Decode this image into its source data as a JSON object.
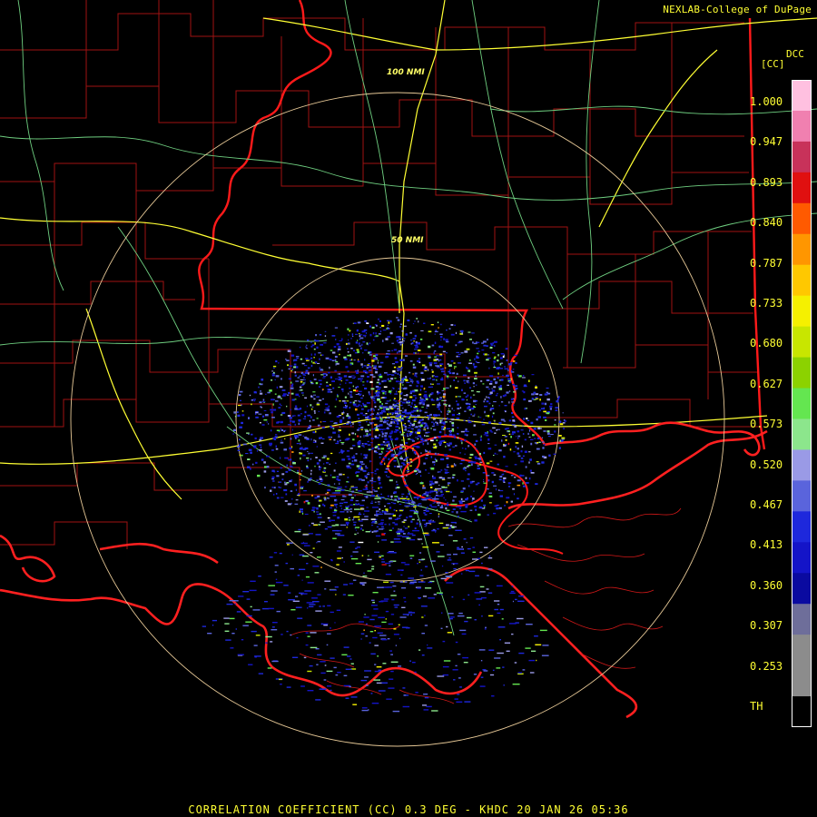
{
  "credit": "NEXLAB-College of DuPage",
  "bottom_title": "CORRELATION COEFFICIENT (CC) 0.3 DEG - KHDC 20 JAN 26 05:36",
  "product_code": "DCC",
  "unit": "[CC]",
  "range_rings": [
    {
      "label": "100 NMI"
    },
    {
      "label": "50 NMI"
    }
  ],
  "colorbar": {
    "labels": [
      "1.000",
      "0.947",
      "0.893",
      "0.840",
      "0.787",
      "0.733",
      "0.680",
      "0.627",
      "0.573",
      "0.520",
      "0.467",
      "0.413",
      "0.360",
      "0.307",
      "0.253",
      "TH"
    ],
    "colors": [
      "#ffc0e0",
      "#f080b0",
      "#c8325a",
      "#e01010",
      "#ff5a00",
      "#ff9600",
      "#ffc800",
      "#f5f000",
      "#c8e600",
      "#8cd200",
      "#64e650",
      "#8ce68c",
      "#9a9ae6",
      "#5a64dc",
      "#1e28dc",
      "#1414c8",
      "#0a0aa0",
      "#6e6e9a",
      "#8c8c8c",
      "#8c8c8c",
      "#000000"
    ]
  },
  "colors": {
    "state_lines": "#ff1a1a",
    "county_lines": "#b41414",
    "highways": "#ffff33",
    "roads": "#7ad68c",
    "rings": "#e6c896",
    "coast": "#ff2020"
  }
}
